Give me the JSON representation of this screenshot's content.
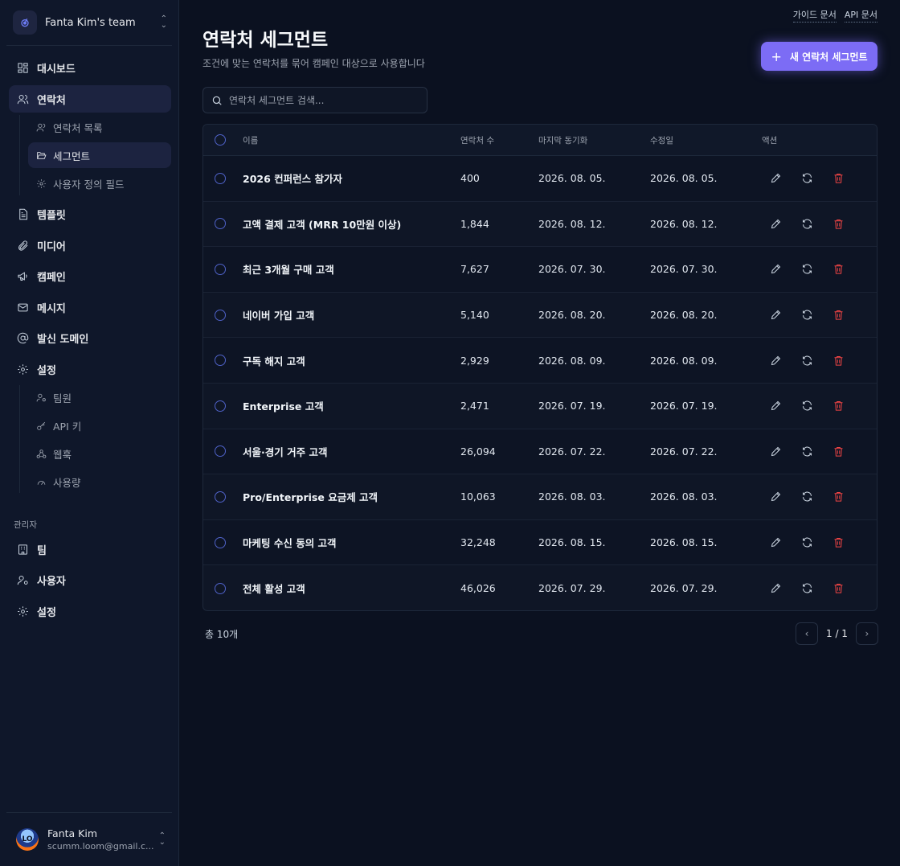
{
  "app": {
    "team_name": "Fanta Kim's team",
    "top_links": [
      "가이드 문서",
      "API 문서"
    ]
  },
  "sidebar": {
    "items": [
      {
        "label": "대시보드",
        "icon": "dashboard-icon"
      },
      {
        "label": "연락처",
        "icon": "users-icon"
      },
      {
        "label": "템플릿",
        "icon": "file-icon"
      },
      {
        "label": "미디어",
        "icon": "paperclip-icon"
      },
      {
        "label": "캠페인",
        "icon": "megaphone-icon"
      },
      {
        "label": "메시지",
        "icon": "mail-icon"
      },
      {
        "label": "발신 도메인",
        "icon": "at-sign-icon"
      },
      {
        "label": "설정",
        "icon": "gear-icon"
      }
    ],
    "contacts_sub": [
      {
        "label": "연락처 목록",
        "icon": "users-icon"
      },
      {
        "label": "세그먼트",
        "icon": "folder-open-icon"
      },
      {
        "label": "사용자 정의 필드",
        "icon": "gear-icon"
      }
    ],
    "settings_sub": [
      {
        "label": "팀원",
        "icon": "user-key-icon"
      },
      {
        "label": "API 키",
        "icon": "key-icon"
      },
      {
        "label": "웹훅",
        "icon": "webhook-icon"
      },
      {
        "label": "사용량",
        "icon": "gauge-icon"
      }
    ],
    "admin_label": "관리자",
    "admin_items": [
      {
        "label": "팀",
        "icon": "building-icon"
      },
      {
        "label": "사용자",
        "icon": "user-key-icon"
      },
      {
        "label": "설정",
        "icon": "gear-icon"
      }
    ],
    "user": {
      "name": "Fanta Kim",
      "email": "scumm.loom@gmail.com",
      "email_shown": "scumm.loom@gmail.c...",
      "avatar_text": "LO"
    }
  },
  "main": {
    "title": "연락처 세그먼트",
    "subtitle": "조건에 맞는 연락처를 묶어 캠페인 대상으로 사용합니다",
    "new_button": "새 연락처 세그먼트",
    "search_placeholder": "연락처 세그먼트 검색...",
    "columns": [
      "이름",
      "연락처 수",
      "마지막 동기화",
      "수정일",
      "액션"
    ],
    "rows": [
      {
        "name": "2026 컨퍼런스 참가자",
        "count": "400",
        "synced": "2026. 08. 05.",
        "modified": "2026. 08. 05."
      },
      {
        "name": "고액 결제 고객 (MRR 10만원 이상)",
        "count": "1,844",
        "synced": "2026. 08. 12.",
        "modified": "2026. 08. 12."
      },
      {
        "name": "최근 3개월 구매 고객",
        "count": "7,627",
        "synced": "2026. 07. 30.",
        "modified": "2026. 07. 30."
      },
      {
        "name": "네이버 가입 고객",
        "count": "5,140",
        "synced": "2026. 08. 20.",
        "modified": "2026. 08. 20."
      },
      {
        "name": "구독 해지 고객",
        "count": "2,929",
        "synced": "2026. 08. 09.",
        "modified": "2026. 08. 09."
      },
      {
        "name": "Enterprise 고객",
        "count": "2,471",
        "synced": "2026. 07. 19.",
        "modified": "2026. 07. 19."
      },
      {
        "name": "서울·경기 거주 고객",
        "count": "26,094",
        "synced": "2026. 07. 22.",
        "modified": "2026. 07. 22."
      },
      {
        "name": "Pro/Enterprise 요금제 고객",
        "count": "10,063",
        "synced": "2026. 08. 03.",
        "modified": "2026. 08. 03."
      },
      {
        "name": "마케팅 수신 동의 고객",
        "count": "32,248",
        "synced": "2026. 08. 15.",
        "modified": "2026. 08. 15."
      },
      {
        "name": "전체 활성 고객",
        "count": "46,026",
        "synced": "2026. 07. 29.",
        "modified": "2026. 07. 29."
      }
    ],
    "total": "총 10개",
    "page": "1 / 1"
  },
  "colors": {
    "accent": "#7c6cf5",
    "delete": "#ef4444",
    "checkbox": "#4f62c8"
  }
}
